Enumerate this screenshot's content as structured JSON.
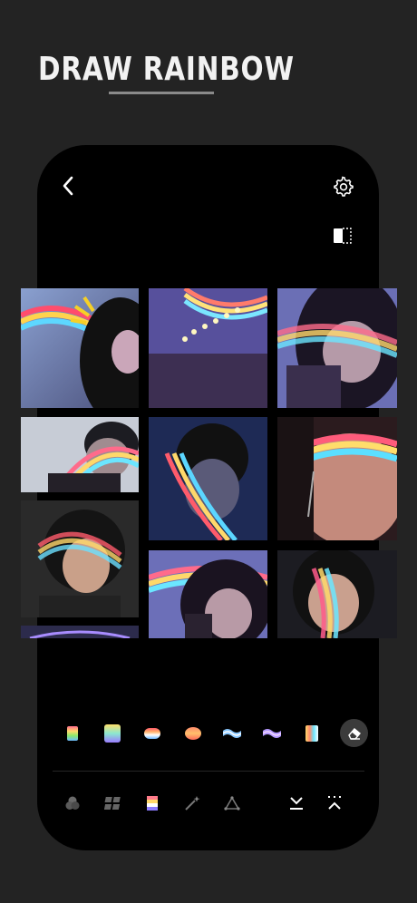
{
  "headline": "DRAW RAINBOW",
  "top_bar": {
    "back_icon": "chevron-left-icon",
    "settings_icon": "gear-icon",
    "compare_icon": "split-compare-icon"
  },
  "gallery": [
    {
      "name": "photo-rainbow-girl-burst"
    },
    {
      "name": "photo-rainbow-wall-lights"
    },
    {
      "name": "photo-rainbow-girl-brush"
    },
    {
      "name": "photo-rainbow-boy-hands"
    },
    {
      "name": "photo-rainbow-boy-profile"
    },
    {
      "name": "photo-rainbow-girl-closeup"
    },
    {
      "name": "photo-rainbow-girl-eyes-closed"
    },
    {
      "name": "photo-rainbow-girl-brush-2"
    },
    {
      "name": "photo-rainbow-girl-smile"
    },
    {
      "name": "photo-rainbow-strip-bottom"
    }
  ],
  "stickers": [
    {
      "name": "rainbow-rect-sticker"
    },
    {
      "name": "rainbow-square-sticker"
    },
    {
      "name": "rainbow-pill-sticker"
    },
    {
      "name": "rainbow-oval-sticker"
    },
    {
      "name": "rainbow-wave-blue-sticker"
    },
    {
      "name": "rainbow-wave-purple-sticker"
    },
    {
      "name": "rainbow-prism-sticker"
    }
  ],
  "eraser_icon": "eraser-icon",
  "toolbar": [
    {
      "name": "tool-color-mix",
      "icon": "circles-icon"
    },
    {
      "name": "tool-grid",
      "icon": "grid-icon"
    },
    {
      "name": "tool-rainbow",
      "icon": "rainbow-layer-icon"
    },
    {
      "name": "tool-magic-wand",
      "icon": "magic-wand-icon"
    },
    {
      "name": "tool-shape",
      "icon": "triangle-icon"
    },
    {
      "name": "tool-collapse-down",
      "icon": "chevron-collapse-down-icon"
    },
    {
      "name": "tool-expand-up",
      "icon": "chevron-expand-up-icon"
    }
  ],
  "colors": {
    "background": "#232323",
    "phone": "#000000",
    "text": "#f2f2f2"
  }
}
